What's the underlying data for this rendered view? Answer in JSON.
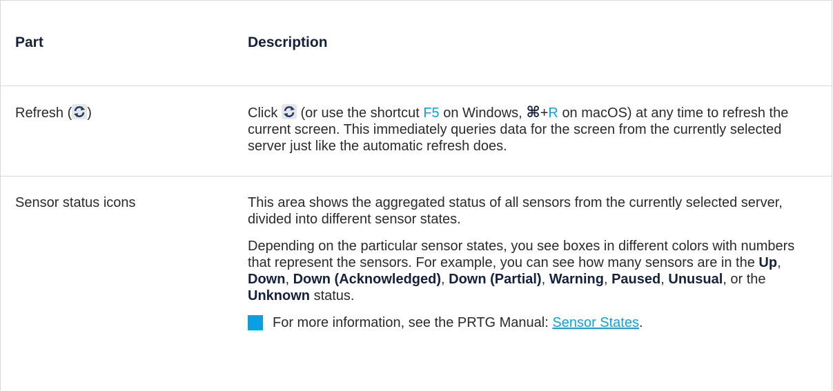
{
  "table": {
    "header": {
      "part": "Part",
      "description": "Description"
    },
    "refresh": {
      "part_label": "Refresh (",
      "part_close": ")",
      "desc_click": "Click",
      "desc_mid1": "(or use the shortcut",
      "shortcut_windows": "F5",
      "desc_mid2": "on Windows,",
      "cmd_symbol": "⌘",
      "plus": "+",
      "shortcut_mac_key": "R",
      "desc_rest": "on macOS) at any time to refresh the current screen. This immediately queries data for the screen from the currently selected server just like the automatic refresh does.",
      "icon": "refresh-icon"
    },
    "sensor": {
      "part_label": "Sensor status icons",
      "para1": "This area shows the aggregated status of all sensors from the currently selected server, divided into different sensor states.",
      "para2_intro": "Depending on the particular sensor states, you see boxes in different colors with numbers that represent the sensors. For example, you can see how many sensors are in the",
      "states": [
        "Up",
        "Down",
        "Down (Acknowledged)",
        "Down (Partial)",
        "Warning",
        "Paused",
        "Unusual",
        "Unknown"
      ],
      "sep": ",",
      "or_the": ", or the",
      "para2_end": "status.",
      "note_text": "For more information, see the PRTG Manual:",
      "note_link": "Sensor States",
      "note_period": ".",
      "note_color": "#08a0e3"
    }
  },
  "colors": {
    "link": "#0aa3e6",
    "heading": "#14213d",
    "border": "#d8d8d8"
  }
}
